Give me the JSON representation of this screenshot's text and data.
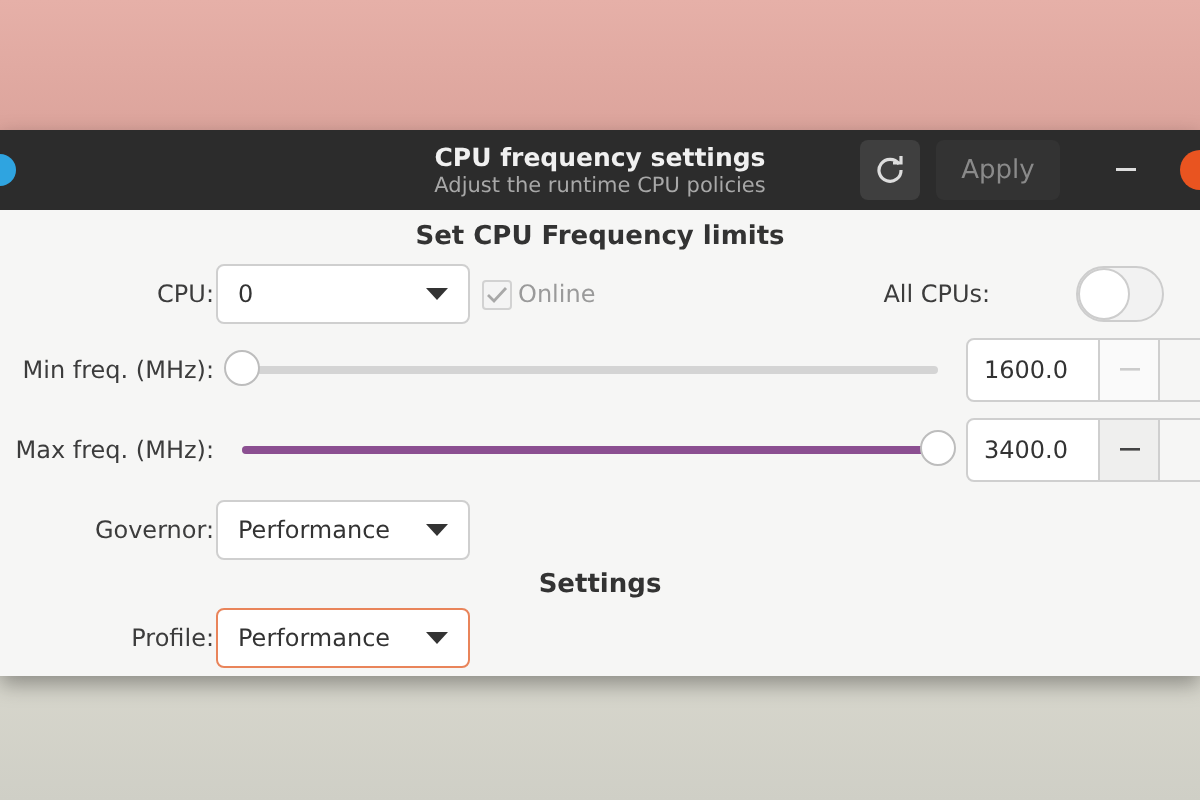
{
  "title_bar": {
    "title": "CPU frequency settings",
    "subtitle": "Adjust the runtime CPU policies",
    "buttons": [
      {
        "kind": "refresh",
        "disabled": false
      },
      {
        "kind": "text",
        "label": "Apply",
        "disabled": true
      }
    ]
  },
  "limits": {
    "heading": "Set CPU Frequency limits",
    "cpu": {
      "label": "CPU:",
      "value": "0"
    },
    "online": {
      "label": "Online",
      "checked": true,
      "disabled": true
    },
    "all_cpus": {
      "label": "All CPUs:",
      "on": false
    },
    "sliders": [
      {
        "label": "Min freq. (MHz):",
        "level": 0,
        "value": "1600.0",
        "minus_disabled": true
      },
      {
        "label": "Max freq. (MHz):",
        "level": 1,
        "value": "3400.0",
        "minus_disabled": false
      }
    ],
    "governor": {
      "label": "Governor:",
      "value": "Performance",
      "focused": false
    }
  },
  "settings": {
    "heading": "Settings",
    "profile": {
      "label": "Profile:",
      "value": "Performance",
      "focused": true
    }
  }
}
